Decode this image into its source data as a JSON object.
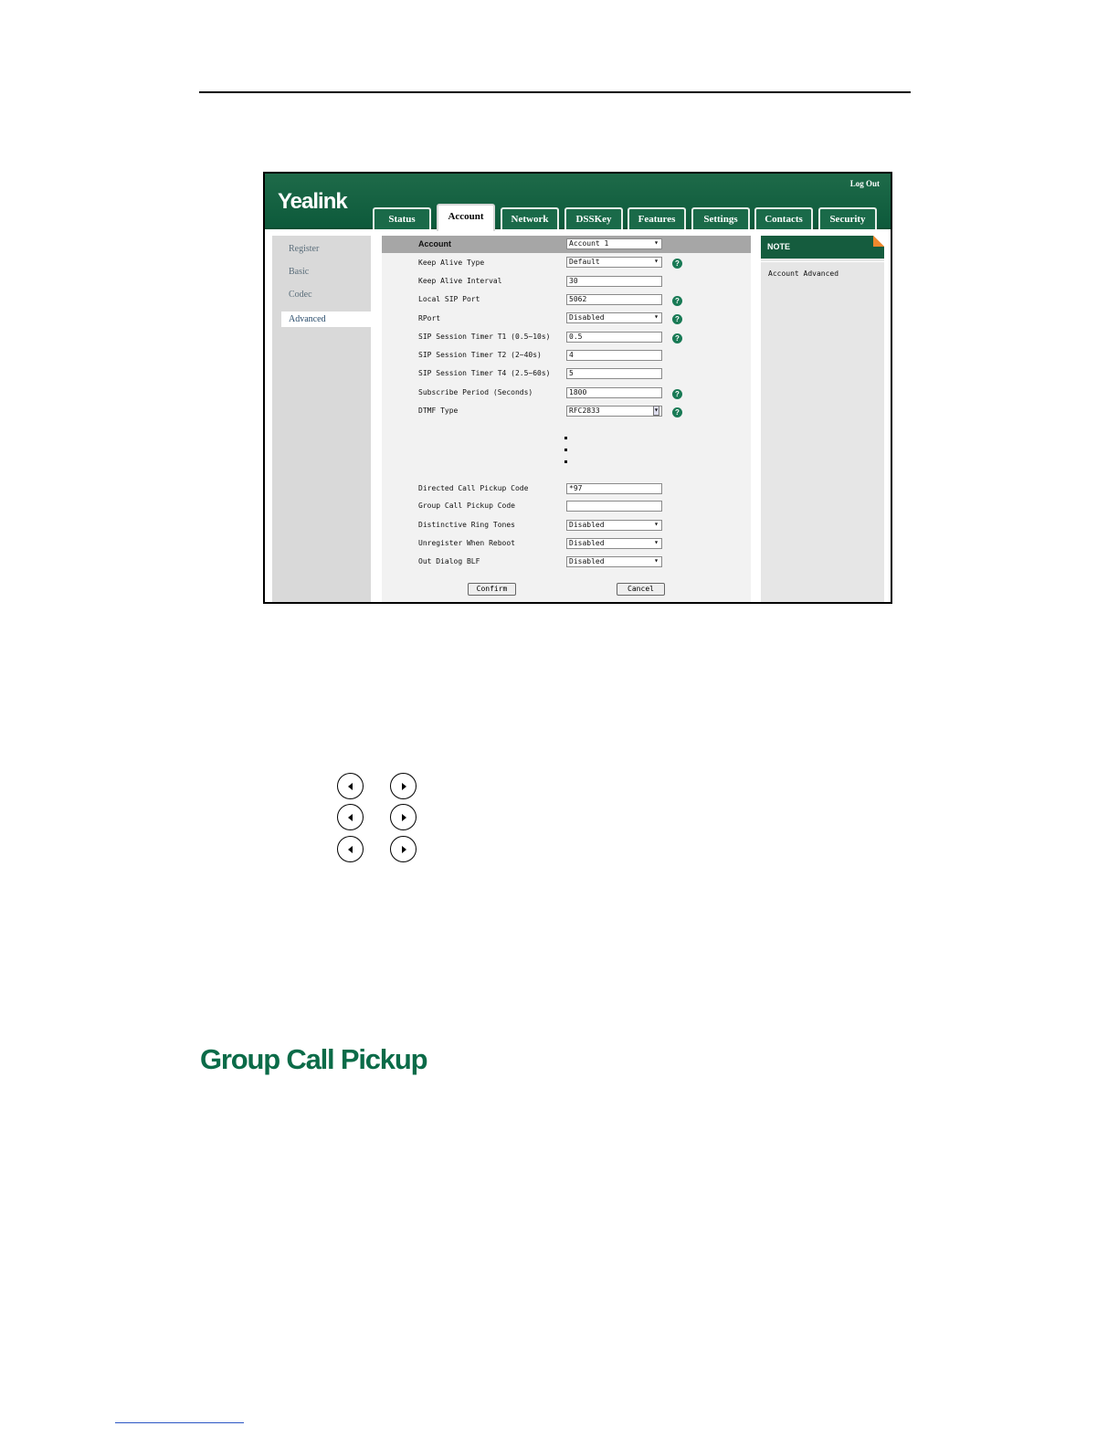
{
  "app": {
    "brand": "Yealink",
    "logout_label": "Log Out",
    "tabs": [
      {
        "label": "Status"
      },
      {
        "label": "Account"
      },
      {
        "label": "Network"
      },
      {
        "label": "DSSKey"
      },
      {
        "label": "Features"
      },
      {
        "label": "Settings"
      },
      {
        "label": "Contacts"
      },
      {
        "label": "Security"
      }
    ],
    "active_tab": "Account",
    "sidebar": [
      {
        "label": "Register"
      },
      {
        "label": "Basic"
      },
      {
        "label": "Codec"
      },
      {
        "label": "Advanced"
      }
    ],
    "active_sidebar": "Advanced",
    "form": {
      "account": {
        "label": "Account",
        "value": "Account 1"
      },
      "keep_alive_type": {
        "label": "Keep Alive Type",
        "value": "Default"
      },
      "keep_alive_interval": {
        "label": "Keep Alive Interval",
        "value": "30"
      },
      "local_sip_port": {
        "label": "Local SIP Port",
        "value": "5062"
      },
      "rport": {
        "label": "RPort",
        "value": "Disabled"
      },
      "t1": {
        "label": "SIP Session Timer T1 (0.5~10s)",
        "value": "0.5"
      },
      "t2": {
        "label": "SIP Session Timer T2 (2~40s)",
        "value": "4"
      },
      "t4": {
        "label": "SIP Session Timer T4 (2.5~60s)",
        "value": "5"
      },
      "subscribe_period": {
        "label": "Subscribe Period (Seconds)",
        "value": "1800"
      },
      "dtmf_type": {
        "label": "DTMF Type",
        "value": "RFC2833"
      },
      "directed_pickup": {
        "label": "Directed Call Pickup Code",
        "value": "*97"
      },
      "group_pickup": {
        "label": "Group Call Pickup Code",
        "value": ""
      },
      "distinctive_ring": {
        "label": "Distinctive Ring Tones",
        "value": "Disabled"
      },
      "unregister_reboot": {
        "label": "Unregister When Reboot",
        "value": "Disabled"
      },
      "out_dialog_blf": {
        "label": "Out Dialog BLF",
        "value": "Disabled"
      }
    },
    "help_glyph": "?",
    "confirm_label": "Confirm",
    "cancel_label": "Cancel",
    "note": {
      "title": "NOTE",
      "text": "Account Advanced"
    }
  },
  "keys": [
    "left-key",
    "right-key"
  ],
  "section_title": "Group Call Pickup"
}
